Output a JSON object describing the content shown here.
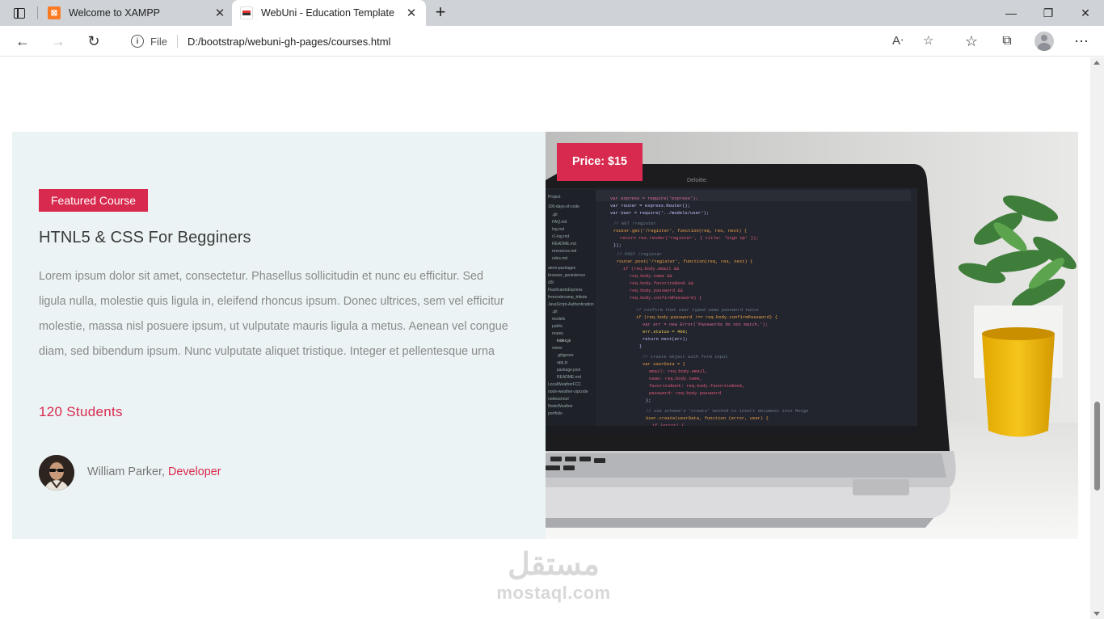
{
  "browser": {
    "tabs": [
      {
        "title": "Welcome to XAMPP",
        "favicon": "xampp-icon",
        "active": false
      },
      {
        "title": "WebUni - Education Template",
        "favicon": "webuni-icon",
        "active": true
      }
    ],
    "new_tab_label": "+",
    "address": {
      "scheme_label": "File",
      "url": "D:/bootstrap/webuni-gh-pages/courses.html"
    }
  },
  "course": {
    "badge": "Featured Course",
    "title": "HTNL5 & CSS For Begginers",
    "description": "Lorem ipsum dolor sit amet, consectetur. Phasellus sollicitudin et nunc eu efficitur. Sed ligula nulla, molestie quis ligula in, eleifend rhoncus ipsum. Donec ultrices, sem vel efficitur molestie, massa nisl posuere ipsum, ut vulputate mauris ligula a metus. Aenean vel congue diam, sed bibendum ipsum. Nunc vulputate aliquet tristique. Integer et pellentesque urna",
    "students": "120 Students",
    "author_name": "William Parker,",
    "author_role": "Developer",
    "price": "Price: $15"
  },
  "watermark": {
    "arabic": "مستقل",
    "latin": "mostaql.com"
  },
  "colors": {
    "accent": "#d82a4e",
    "card_background": "#ebf3f4"
  }
}
